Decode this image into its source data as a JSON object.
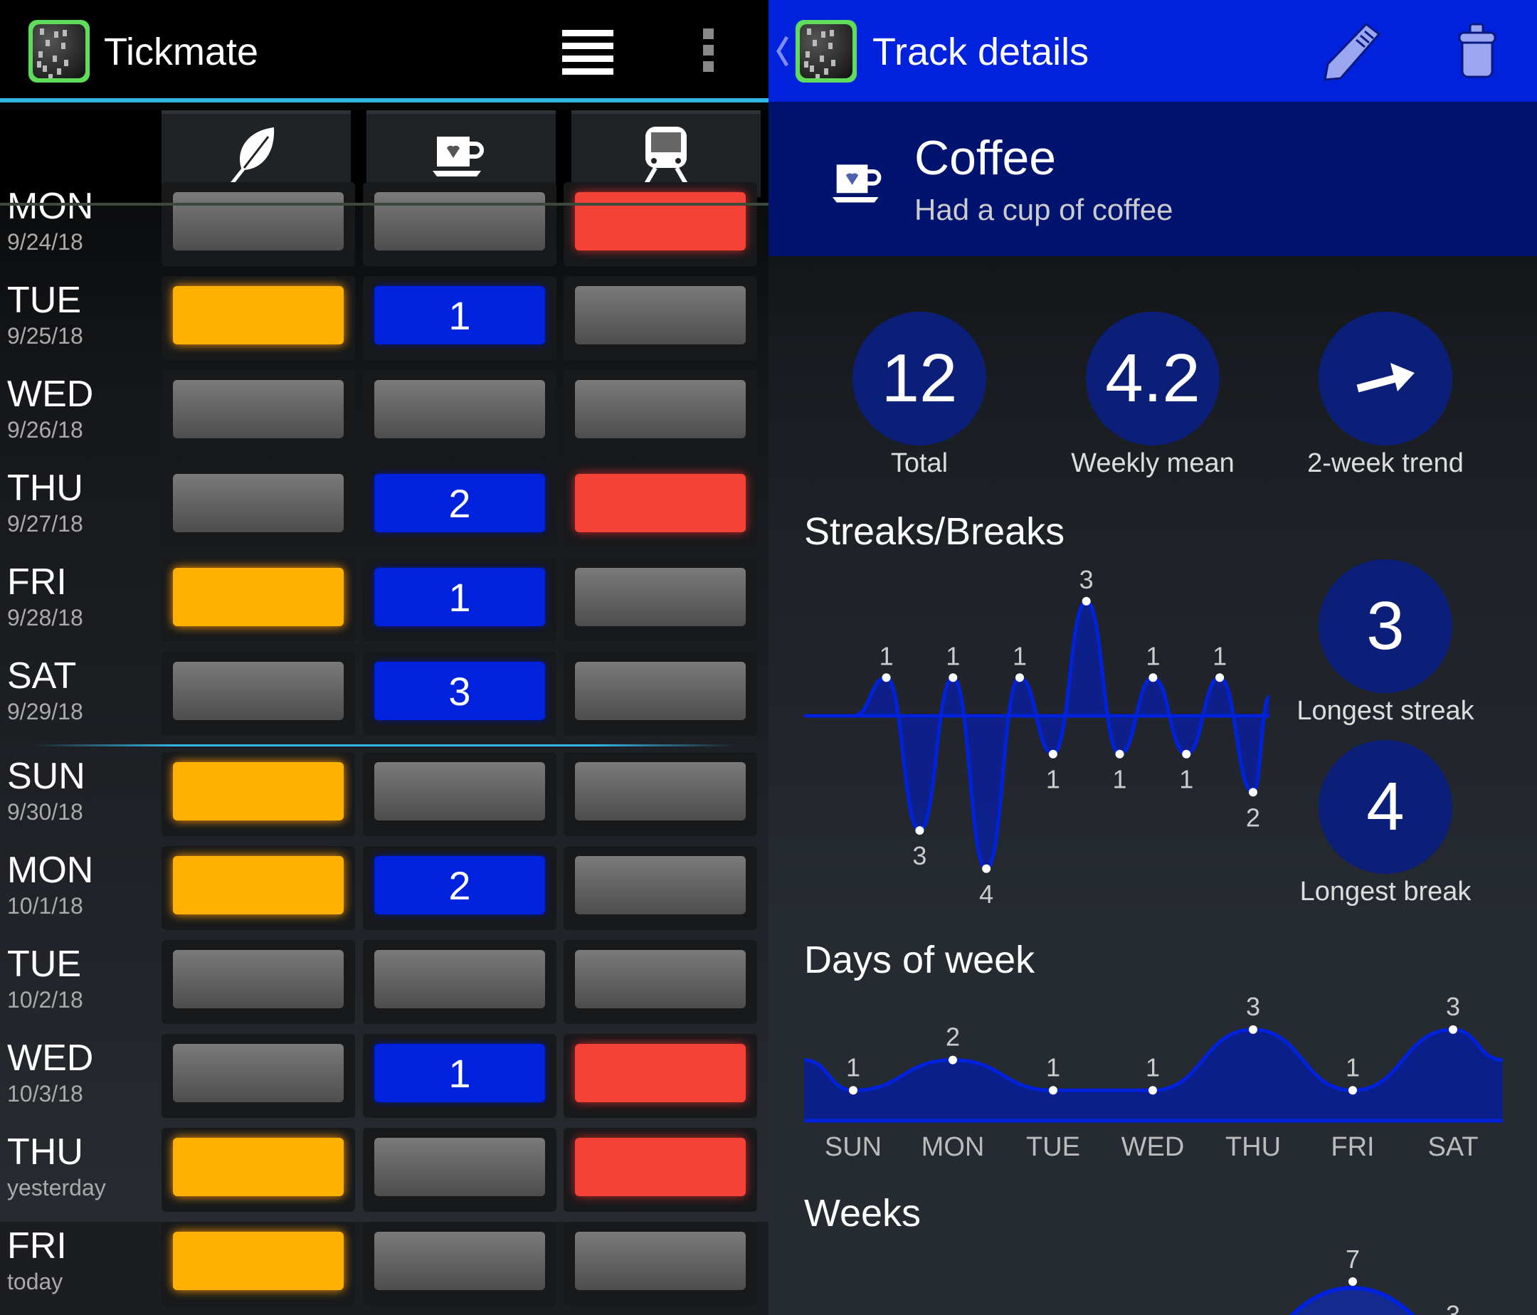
{
  "left": {
    "app_title": "Tickmate",
    "icons": {
      "menu": "list-icon",
      "overflow": "more-vert-icon"
    },
    "tracks": [
      {
        "icon": "leaf-icon"
      },
      {
        "icon": "coffee-cup-icon"
      },
      {
        "icon": "train-icon"
      }
    ],
    "colors": {
      "orange": "#ffb000",
      "blue": "#0022dd",
      "red": "#f44336",
      "gray": "#5a5a5a"
    },
    "rows": [
      {
        "day": "MON",
        "date": "9/24/18",
        "cells": [
          {
            "c": "gray"
          },
          {
            "c": "gray"
          },
          {
            "c": "red"
          }
        ]
      },
      {
        "day": "TUE",
        "date": "9/25/18",
        "cells": [
          {
            "c": "orange"
          },
          {
            "c": "blue",
            "n": "1"
          },
          {
            "c": "gray"
          }
        ]
      },
      {
        "day": "WED",
        "date": "9/26/18",
        "cells": [
          {
            "c": "gray"
          },
          {
            "c": "gray"
          },
          {
            "c": "gray"
          }
        ]
      },
      {
        "day": "THU",
        "date": "9/27/18",
        "cells": [
          {
            "c": "gray"
          },
          {
            "c": "blue",
            "n": "2"
          },
          {
            "c": "red"
          }
        ]
      },
      {
        "day": "FRI",
        "date": "9/28/18",
        "cells": [
          {
            "c": "orange"
          },
          {
            "c": "blue",
            "n": "1"
          },
          {
            "c": "gray"
          }
        ]
      },
      {
        "day": "SAT",
        "date": "9/29/18",
        "cells": [
          {
            "c": "gray"
          },
          {
            "c": "blue",
            "n": "3"
          },
          {
            "c": "gray"
          }
        ]
      },
      {
        "day": "SUN",
        "date": "9/30/18",
        "cells": [
          {
            "c": "orange"
          },
          {
            "c": "gray"
          },
          {
            "c": "gray"
          }
        ]
      },
      {
        "day": "MON",
        "date": "10/1/18",
        "cells": [
          {
            "c": "orange"
          },
          {
            "c": "blue",
            "n": "2"
          },
          {
            "c": "gray"
          }
        ]
      },
      {
        "day": "TUE",
        "date": "10/2/18",
        "cells": [
          {
            "c": "gray"
          },
          {
            "c": "gray"
          },
          {
            "c": "gray"
          }
        ]
      },
      {
        "day": "WED",
        "date": "10/3/18",
        "cells": [
          {
            "c": "gray"
          },
          {
            "c": "blue",
            "n": "1"
          },
          {
            "c": "red"
          }
        ]
      },
      {
        "day": "THU",
        "date": "yesterday",
        "cells": [
          {
            "c": "orange"
          },
          {
            "c": "gray"
          },
          {
            "c": "red"
          }
        ]
      },
      {
        "day": "FRI",
        "date": "today",
        "cells": [
          {
            "c": "orange"
          },
          {
            "c": "gray"
          },
          {
            "c": "gray"
          }
        ]
      }
    ]
  },
  "right": {
    "title": "Track details",
    "icons": {
      "back": "chevron-left-icon",
      "edit": "pencil-icon",
      "delete": "trash-icon",
      "track": "coffee-cup-icon"
    },
    "track_name": "Coffee",
    "track_desc": "Had a cup of coffee",
    "stats": {
      "total": "12",
      "total_label": "Total",
      "weekly_mean": "4.2",
      "weekly_mean_label": "Weekly mean",
      "trend_label": "2-week trend",
      "trend_icon": "arrow-up-right-icon"
    },
    "streaks_title": "Streaks/Breaks",
    "longest_streak": "3",
    "longest_streak_label": "Longest streak",
    "longest_break": "4",
    "longest_break_label": "Longest break",
    "days_title": "Days of week",
    "weeks_title": "Weeks",
    "accent": "#0022dd"
  },
  "chart_data": [
    {
      "type": "area",
      "title": "Streaks/Breaks",
      "series": [
        {
          "values": [
            1,
            -3,
            1,
            -4,
            1,
            -1,
            3,
            -1,
            1,
            -1,
            1,
            -2
          ]
        }
      ],
      "labels": [
        "1",
        "3",
        "1",
        "4",
        "1",
        "1",
        "3",
        "1",
        "1",
        "1",
        "1",
        "2"
      ]
    },
    {
      "type": "area",
      "title": "Days of week",
      "categories": [
        "SUN",
        "MON",
        "TUE",
        "WED",
        "THU",
        "FRI",
        "SAT"
      ],
      "values": [
        1,
        2,
        1,
        1,
        3,
        1,
        3
      ]
    },
    {
      "type": "area",
      "title": "Weeks",
      "values": [
        7,
        3
      ],
      "partial": true
    }
  ]
}
